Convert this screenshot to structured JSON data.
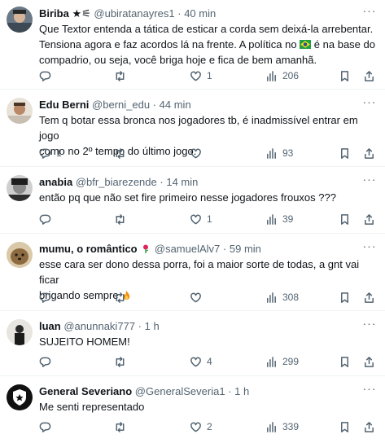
{
  "tweets": [
    {
      "name": "Biriba ★⚟",
      "handle": "@ubiratanayres1",
      "time": "40 min",
      "lines": [
        "Que Textor entenda a tática de esticar a corda sem deixá-la arrebentar.",
        "Tensiona agora e faz acordos lá na frente. A política no",
        "é na base do",
        "compadrio, ou seja, você briga hoje e fica de bem amanhã."
      ],
      "replies": "",
      "reposts": "",
      "likes": "1",
      "views": "206"
    },
    {
      "name": "Edu Berni",
      "handle": "@berni_edu",
      "time": "44 min",
      "lines": [
        "Tem q botar essa bronca nos jogadores tb, é inadmissível entrar em jogo",
        "como no 2º tempo do último jogo."
      ],
      "replies": "1",
      "reposts": "",
      "likes": "",
      "views": "93"
    },
    {
      "name": "anabia",
      "handle": "@bfr_biarezende",
      "time": "14 min",
      "lines": [
        "então pq que não set fire primeiro nesse jogadores frouxos ???"
      ],
      "replies": "",
      "reposts": "",
      "likes": "1",
      "views": "39"
    },
    {
      "name": "mumu, o romântico",
      "handle": "@samuelAlv7",
      "time": "59 min",
      "lines": [
        "esse cara ser dono dessa porra, foi a maior sorte de todas, a gnt vai ficar",
        "brigando sempre"
      ],
      "replies": "",
      "reposts": "",
      "likes": "",
      "views": "308"
    },
    {
      "name": "luan",
      "handle": "@anunnaki777",
      "time": "1 h",
      "lines": [
        "SUJEITO HOMEM!"
      ],
      "replies": "",
      "reposts": "",
      "likes": "4",
      "views": "299"
    },
    {
      "name": "General Severiano",
      "handle": "@GeneralSeveria1",
      "time": "1 h",
      "lines": [
        "Me senti representado"
      ],
      "replies": "",
      "reposts": "",
      "likes": "2",
      "views": "339"
    }
  ],
  "separator": "·",
  "icons": [
    "reply-icon",
    "repost-icon",
    "like-icon",
    "views-icon",
    "bookmark-icon",
    "share-icon",
    "more-icon",
    "brazil-flag-icon",
    "rose-icon",
    "fire-icon"
  ]
}
